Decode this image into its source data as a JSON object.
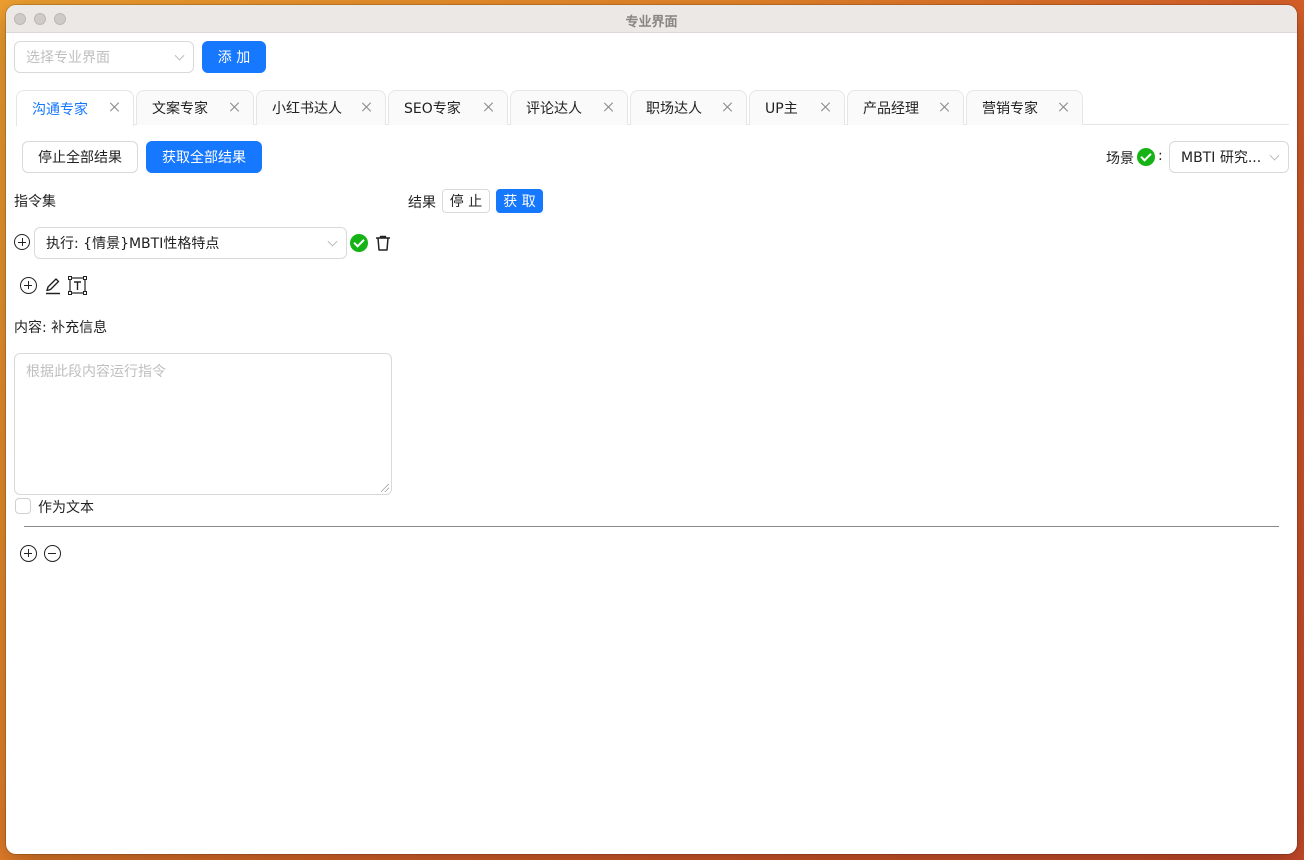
{
  "window": {
    "title": "专业界面"
  },
  "toolbar": {
    "select_placeholder": "选择专业界面",
    "add_label": "添 加"
  },
  "tabs": [
    {
      "label": "沟通专家",
      "active": true
    },
    {
      "label": "文案专家"
    },
    {
      "label": "小红书达人"
    },
    {
      "label": "SEO专家"
    },
    {
      "label": "评论达人"
    },
    {
      "label": "职场达人"
    },
    {
      "label": "UP主"
    },
    {
      "label": "产品经理"
    },
    {
      "label": "营销专家"
    }
  ],
  "actions": {
    "stop_all_label": "停止全部结果",
    "get_all_label": "获取全部结果",
    "scene_label": "场景",
    "scene_colon": ":",
    "scene_value": "MBTI 研究..."
  },
  "commands": {
    "heading": "指令集",
    "command_value": "执行: {情景}MBTI性格特点"
  },
  "results": {
    "label": "结果",
    "stop_label": "停 止",
    "get_label": "获 取"
  },
  "content": {
    "label": "内容: 补充信息",
    "placeholder": "根据此段内容运行指令",
    "as_text_label": "作为文本"
  },
  "colors": {
    "primary": "#1677ff",
    "success": "#16b316"
  }
}
